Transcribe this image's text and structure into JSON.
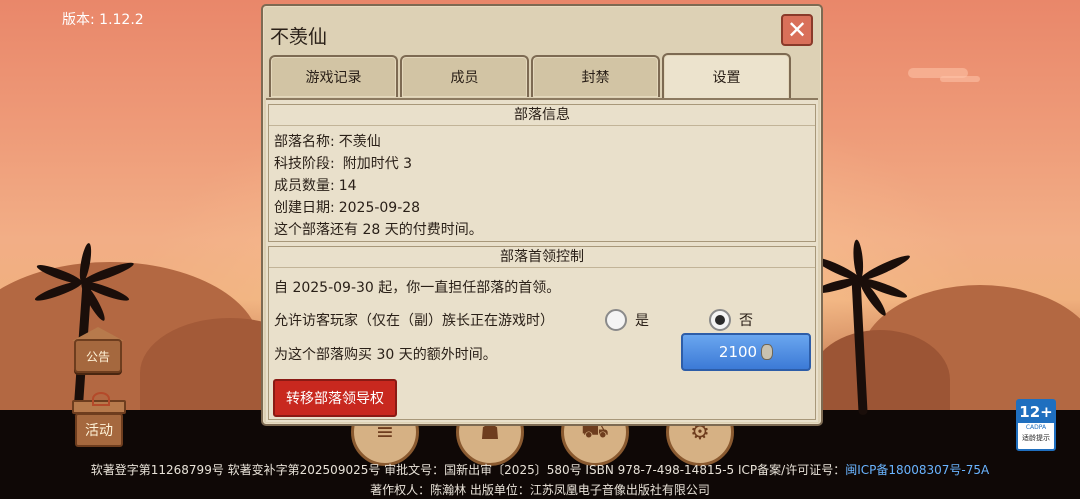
{
  "version_text": "版本: 1.12.2",
  "dialog": {
    "title": "不羡仙",
    "close_symbol": "✕",
    "tabs": [
      {
        "label": "游戏记录",
        "active": false
      },
      {
        "label": "成员",
        "active": false
      },
      {
        "label": "封禁",
        "active": false
      },
      {
        "label": "设置",
        "active": true
      }
    ]
  },
  "tribe_info": {
    "title": "部落信息",
    "name_label": "部落名称:",
    "name_value": "不羡仙",
    "tech_label": "科技阶段:",
    "tech_value": "附加时代 3",
    "members_label": "成员数量:",
    "members_value": "14",
    "created_label": "创建日期:",
    "created_value": "2025-09-28",
    "paid_time_text": "这个部落还有 28 天的付费时间。"
  },
  "leader_control": {
    "title": "部落首领控制",
    "leader_since_text": "自 2025-09-30 起，你一直担任部落的首领。",
    "visitor_label": "允许访客玩家（仅在（副）族长正在游戏时）",
    "option_yes": "是",
    "option_no": "否",
    "selected": "否",
    "buy_text": "为这个部落购买 30 天的额外时间。",
    "buy_price": "2100",
    "transfer_button": "转移部落领导权"
  },
  "side": {
    "notice_label": "公告",
    "activity_label": "活动"
  },
  "footer": {
    "line1": "软著登字第11268799号 软著变补字第202509025号 审批文号：国新出审〔2025〕580号 ISBN 978-7-498-14815-5 ICP备案/许可证号：",
    "icp_link": "闽ICP备18008307号-75A",
    "line2": "著作权人：陈瀚林 出版单位：江苏凤凰电子音像出版社有限公司"
  },
  "age_badge": {
    "rating": "12+",
    "org": "CADPA",
    "note": "适龄提示"
  },
  "colors": {
    "dialog_bg": "#ddd1b5",
    "buy_button": "#3c7ad6",
    "transfer_button": "#c8281f",
    "close_button": "#d9705a",
    "icp_link": "#6ab4ff"
  }
}
